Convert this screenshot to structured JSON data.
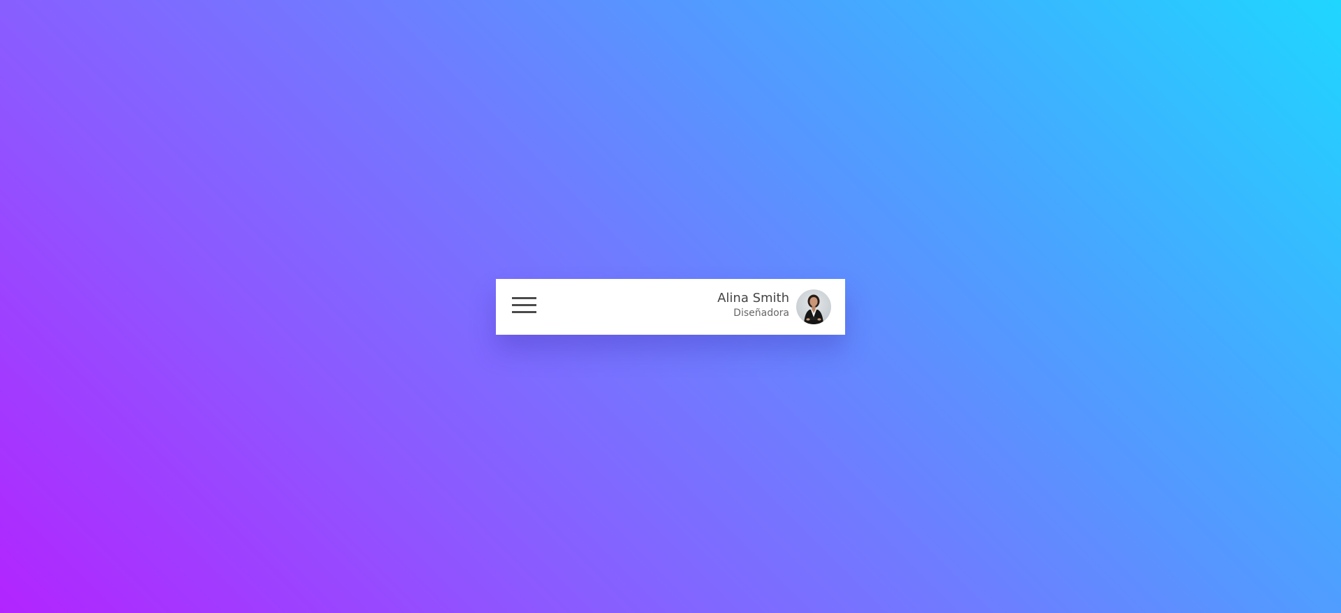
{
  "header": {
    "menu_icon": "hamburger-menu-icon",
    "user": {
      "name": "Alina Smith",
      "role": "Diseñadora",
      "avatar": "user-avatar-photo"
    }
  },
  "colors": {
    "background_start": "#b224ff",
    "background_end": "#1fd6ff",
    "card": "#ffffff",
    "text_primary": "#444444",
    "text_secondary": "#666666",
    "icon": "#4a4a4a"
  }
}
